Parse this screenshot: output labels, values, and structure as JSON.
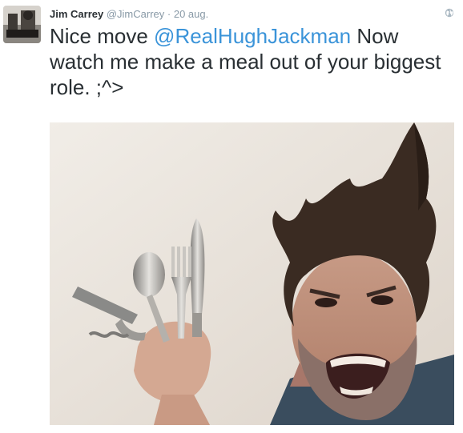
{
  "tweet": {
    "author_name": "Jim Carrey",
    "author_handle": "@JimCarrey",
    "separator": "·",
    "timestamp": "20 aug.",
    "text_before": "Nice move ",
    "mention": "@RealHughJackman",
    "text_after": " Now watch me make a meal out of your biggest role. ;^>"
  },
  "colors": {
    "link": "#3b94d9",
    "meta": "#8899a6",
    "text": "#292f33"
  },
  "icons": {
    "visibility": "globe-icon"
  }
}
